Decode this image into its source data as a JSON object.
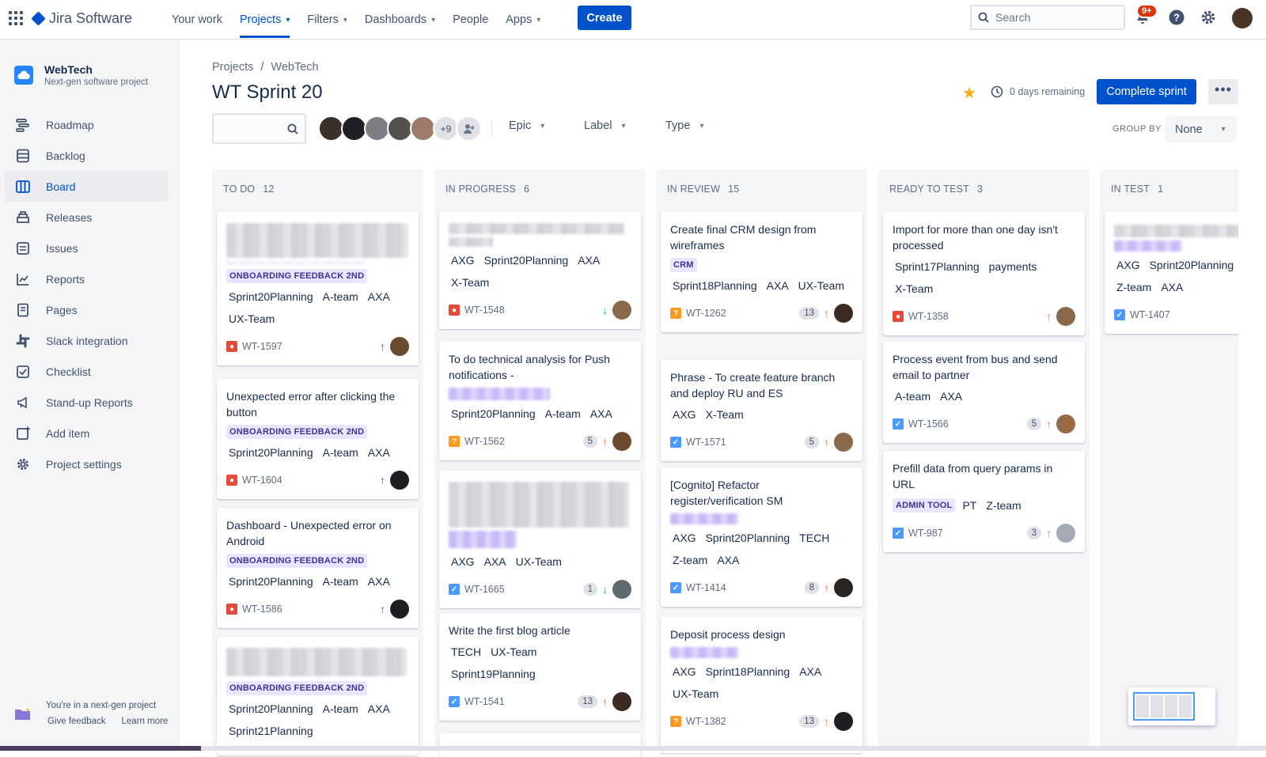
{
  "topnav": {
    "product": "Jira Software",
    "items": [
      {
        "label": "Your work",
        "dropdown": false,
        "active": false
      },
      {
        "label": "Projects",
        "dropdown": true,
        "active": true
      },
      {
        "label": "Filters",
        "dropdown": true,
        "active": false
      },
      {
        "label": "Dashboards",
        "dropdown": true,
        "active": false
      },
      {
        "label": "People",
        "dropdown": false,
        "active": false
      },
      {
        "label": "Apps",
        "dropdown": true,
        "active": false
      }
    ],
    "create_label": "Create",
    "search_placeholder": "Search",
    "notifications_badge": "9+"
  },
  "sidebar": {
    "project_name": "WebTech",
    "project_type": "Next-gen software project",
    "items": [
      {
        "label": "Roadmap",
        "icon": "roadmap-icon"
      },
      {
        "label": "Backlog",
        "icon": "backlog-icon"
      },
      {
        "label": "Board",
        "icon": "board-icon",
        "active": true
      },
      {
        "label": "Releases",
        "icon": "releases-icon"
      },
      {
        "label": "Issues",
        "icon": "issues-icon"
      },
      {
        "label": "Reports",
        "icon": "reports-icon"
      },
      {
        "label": "Pages",
        "icon": "pages-icon"
      },
      {
        "label": "Slack integration",
        "icon": "slack-icon"
      },
      {
        "label": "Checklist",
        "icon": "checklist-icon"
      },
      {
        "label": "Stand-up Reports",
        "icon": "megaphone-icon"
      },
      {
        "label": "Add item",
        "icon": "add-item-icon"
      },
      {
        "label": "Project settings",
        "icon": "gear-icon"
      }
    ],
    "footer_text": "You're in a next-gen project",
    "feedback_link": "Give feedback",
    "learn_more_link": "Learn more"
  },
  "header": {
    "breadcrumbs": [
      "Projects",
      "WebTech"
    ],
    "title": "WT Sprint 20",
    "days_remaining": "0 days remaining",
    "complete_sprint": "Complete sprint",
    "more_label": "•••"
  },
  "filters": {
    "more_avatars": "+9",
    "epic": "Epic",
    "label": "Label",
    "type": "Type",
    "group_by_label": "GROUP BY",
    "group_by_value": "None"
  },
  "columns": [
    {
      "name": "TO DO",
      "count": "12"
    },
    {
      "name": "IN PROGRESS",
      "count": "6"
    },
    {
      "name": "IN REVIEW",
      "count": "15"
    },
    {
      "name": "READY TO TEST",
      "count": "3"
    },
    {
      "name": "IN TEST",
      "count": "1"
    }
  ],
  "cards": {
    "c1": {
      "epic": "ONBOARDING FEEDBACK 2ND",
      "labels": [
        "Sprint20Planning",
        "A-team",
        "AXA",
        "UX-Team"
      ],
      "key": "WT-1597"
    },
    "c2": {
      "title": "Unexpected error after clicking the button",
      "epic": "ONBOARDING FEEDBACK 2ND",
      "labels": [
        "Sprint20Planning",
        "A-team",
        "AXA"
      ],
      "key": "WT-1604"
    },
    "c3": {
      "title": "Dashboard - Unexpected error on Android",
      "epic": "ONBOARDING FEEDBACK 2ND",
      "labels": [
        "Sprint20Planning",
        "A-team",
        "AXA"
      ],
      "key": "WT-1586"
    },
    "c4": {
      "epic": "ONBOARDING FEEDBACK 2ND",
      "labels": [
        "Sprint20Planning",
        "A-team",
        "AXA",
        "Sprint21Planning"
      ]
    },
    "p1": {
      "labels": [
        "AXG",
        "Sprint20Planning",
        "AXA",
        "X-Team"
      ],
      "key": "WT-1548"
    },
    "p2": {
      "title": "To do technical analysis for Push notifications -",
      "labels": [
        "Sprint20Planning",
        "A-team",
        "AXA"
      ],
      "key": "WT-1562",
      "est": "5"
    },
    "p3": {
      "labels": [
        "AXG",
        "AXA",
        "UX-Team"
      ],
      "key": "WT-1665",
      "est": "1"
    },
    "p4": {
      "title": "Write the first blog article",
      "labels": [
        "TECH",
        "UX-Team",
        "Sprint19Planning"
      ],
      "key": "WT-1541",
      "est": "13"
    },
    "r1": {
      "title": "Create final CRM design from wireframes",
      "epic": "CRM",
      "labels": [
        "Sprint18Planning",
        "AXA",
        "UX-Team"
      ],
      "key": "WT-1262",
      "est": "13"
    },
    "r2": {
      "title": "Phrase - To create feature branch and deploy RU and ES",
      "labels": [
        "AXG",
        "X-Team"
      ],
      "key": "WT-1571",
      "est": "5"
    },
    "r3": {
      "title": "[Cognito] Refactor register/verification SM",
      "labels": [
        "AXG",
        "Sprint20Planning",
        "TECH",
        "Z-team",
        "AXA"
      ],
      "key": "WT-1414",
      "est": "8"
    },
    "r4": {
      "title": "Deposit process design",
      "labels": [
        "AXG",
        "Sprint18Planning",
        "AXA",
        "UX-Team"
      ],
      "key": "WT-1382",
      "est": "13"
    },
    "t1": {
      "title": "Import for more than one day isn't processed",
      "labels": [
        "Sprint17Planning",
        "payments",
        "X-Team"
      ],
      "key": "WT-1358"
    },
    "t2": {
      "title": "Process event from bus and send email to partner",
      "labels": [
        "A-team",
        "AXA"
      ],
      "key": "WT-1566",
      "est": "5"
    },
    "t3": {
      "title": "Prefill data from query params in URL",
      "epic": "ADMIN TOOL",
      "labels": [
        "PT",
        "Z-team"
      ],
      "key": "WT-987",
      "est": "3"
    },
    "i1": {
      "labels": [
        "AXG",
        "Sprint20Planning",
        "Z-team",
        "AXA"
      ],
      "key": "WT-1407"
    }
  },
  "colors": {
    "accent": "#0052cc",
    "epic_bg": "#eae6ff",
    "epic_text": "#403294",
    "bug": "#e5493a",
    "story": "#4c9aff",
    "question": "#ff991f"
  }
}
